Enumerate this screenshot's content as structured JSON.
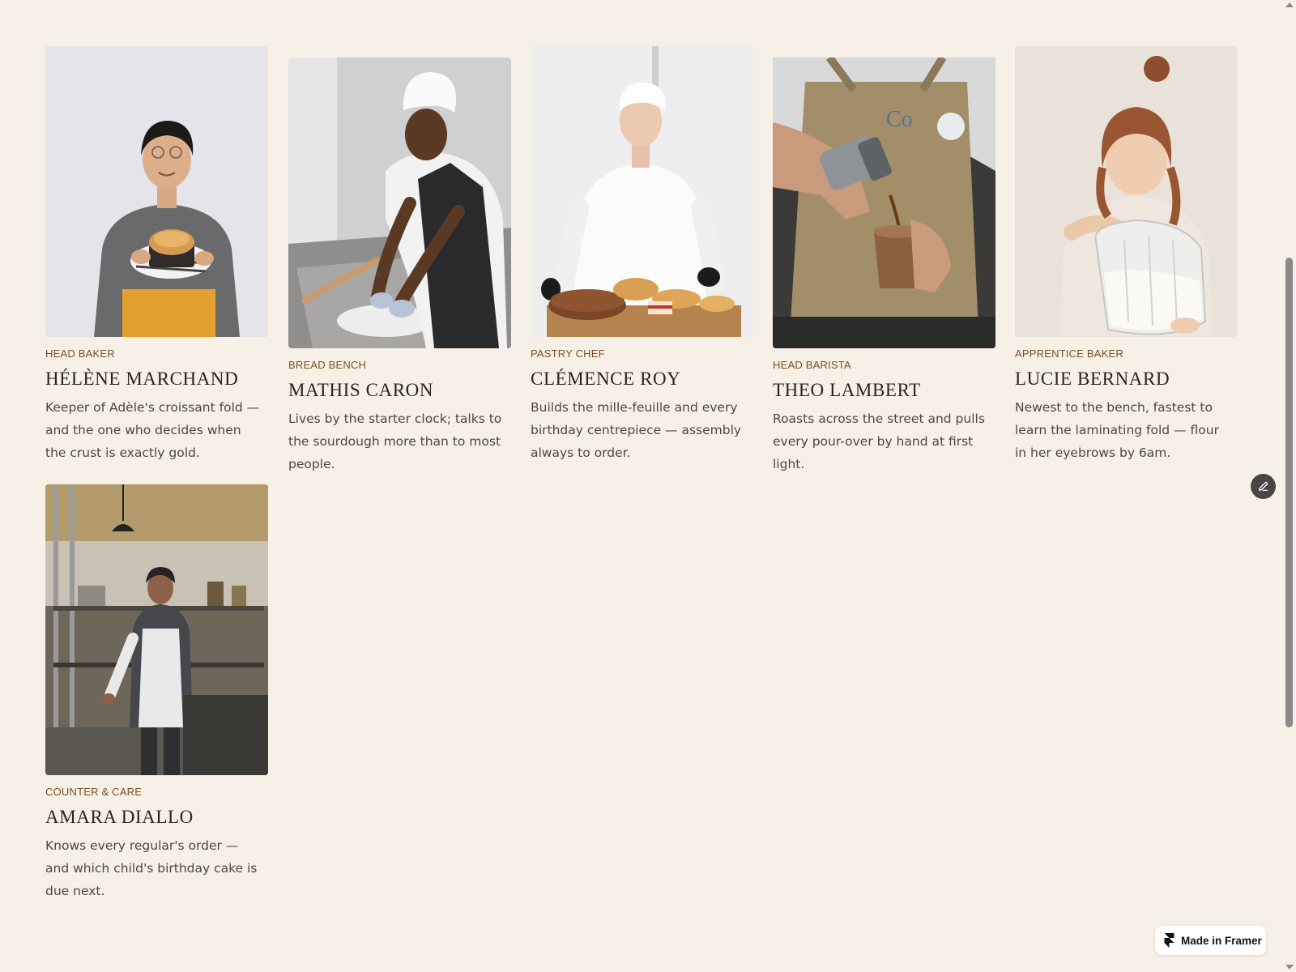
{
  "team": [
    {
      "role": "Head Baker",
      "name": "Hélène Marchand",
      "description": "Keeper of Adèle's croissant fold — and the one who decides when the crust is exactly gold.",
      "photo": "baker-holding-bread-loaf-photo"
    },
    {
      "role": "Bread Bench",
      "name": "Mathis Caron",
      "description": "Lives by the starter clock; talks to the sourdough more than to most people.",
      "photo": "baker-kneading-dough-photo"
    },
    {
      "role": "Pastry Chef",
      "name": "Clémence Roy",
      "description": "Builds the mille-feuille and every birthday centrepiece — assembly always to order.",
      "photo": "pastry-chef-with-cakes-photo"
    },
    {
      "role": "Head Barista",
      "name": "Theo Lambert",
      "description": "Roasts across the street and pulls every pour-over by hand at first light.",
      "photo": "barista-pouring-coffee-photo"
    },
    {
      "role": "Apprentice Baker",
      "name": "Lucie Bernard",
      "description": "Newest to the bench, fastest to learn the laminating fold — flour in her eyebrows by 6am.",
      "photo": "girl-holding-flour-jar-photo"
    },
    {
      "role": "Counter & Care",
      "name": "Amara Diallo",
      "description": "Knows every regular's order — and which child's birthday cake is due next.",
      "photo": "woman-in-kitchen-photo"
    }
  ],
  "badge": {
    "label": "Made in Framer",
    "icon": "framer-logo-icon"
  },
  "edit_button": {
    "icon": "pencil-icon"
  },
  "colors": {
    "background": "#f7f0e6",
    "role": "#7a4f24",
    "name": "#2a2420",
    "description": "#4e4640"
  }
}
